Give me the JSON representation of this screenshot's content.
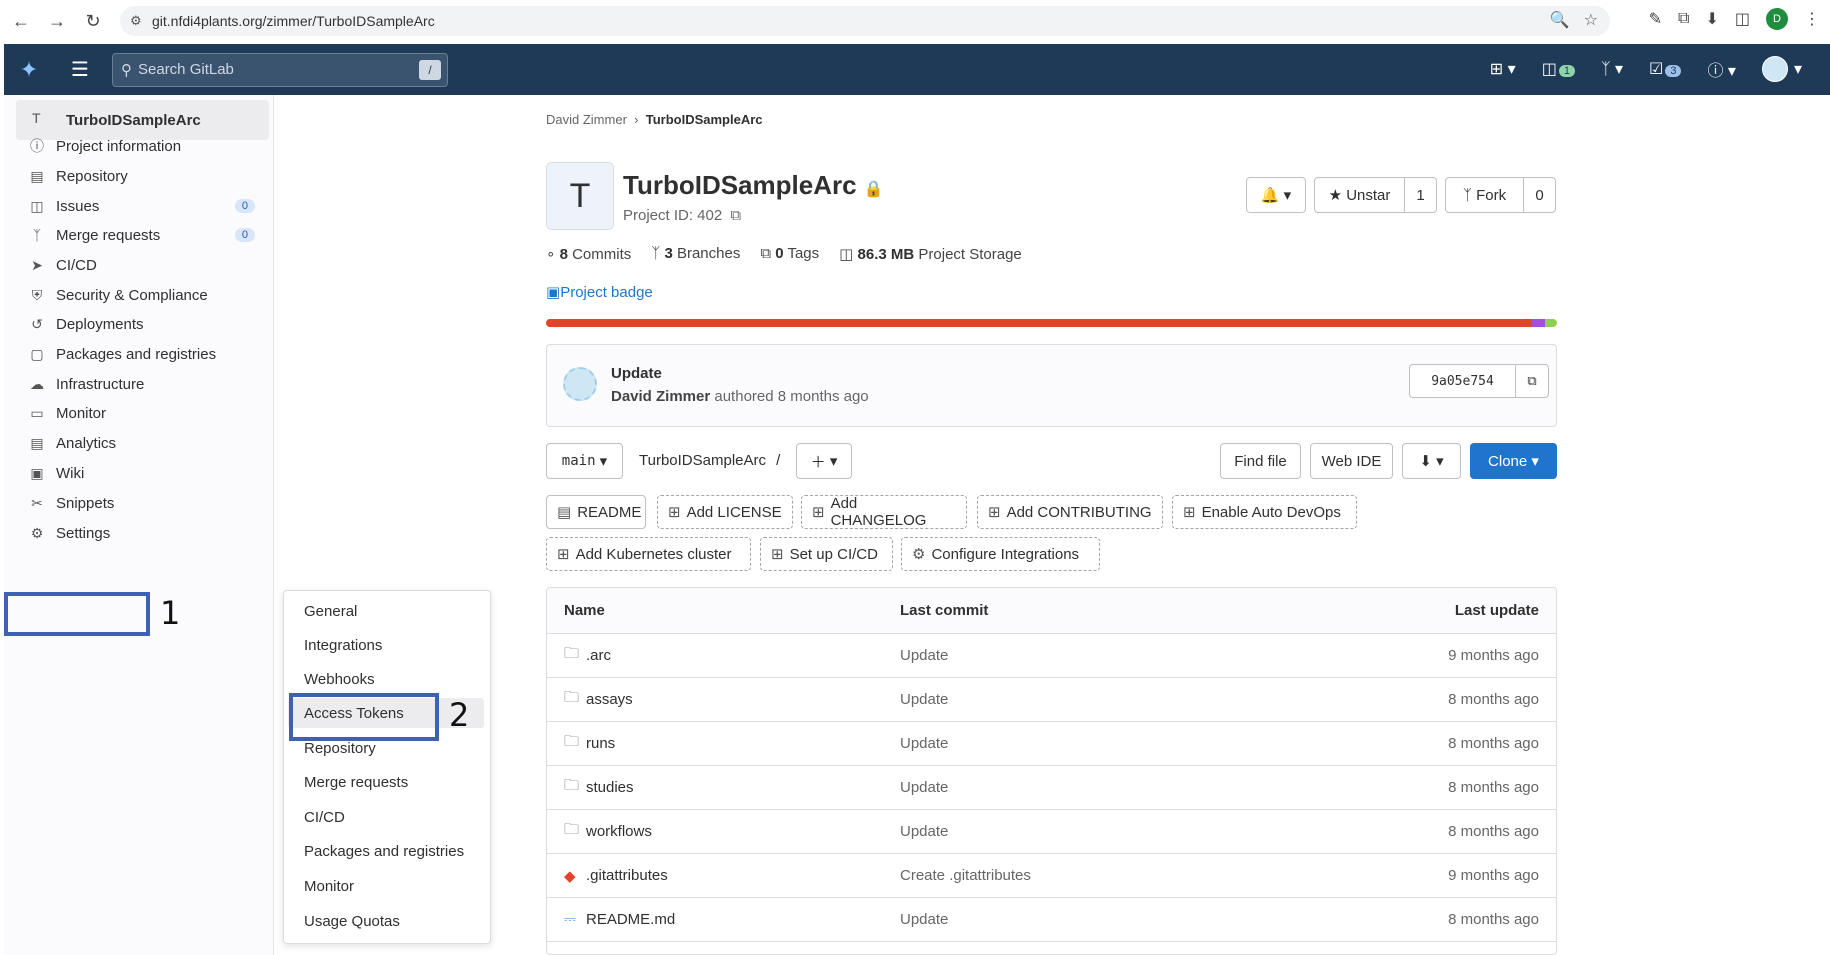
{
  "browser": {
    "url": "git.nfdi4plants.org/zimmer/TurboIDSampleArc",
    "profile_initial": "D"
  },
  "topnav": {
    "search_placeholder": "Search GitLab",
    "search_shortcut": "/",
    "issues_count": "1",
    "todo_count": "3"
  },
  "sidebar": {
    "project_initial": "T",
    "project_name": "TurboIDSampleArc",
    "items": [
      {
        "label": "Project information",
        "icon": "info-icon"
      },
      {
        "label": "Repository",
        "icon": "doc-icon"
      },
      {
        "label": "Issues",
        "icon": "issues-icon",
        "count": "0"
      },
      {
        "label": "Merge requests",
        "icon": "merge-icon",
        "count": "0"
      },
      {
        "label": "CI/CD",
        "icon": "rocket-icon"
      },
      {
        "label": "Security & Compliance",
        "icon": "shield-icon"
      },
      {
        "label": "Deployments",
        "icon": "deploy-icon"
      },
      {
        "label": "Packages and registries",
        "icon": "package-icon"
      },
      {
        "label": "Infrastructure",
        "icon": "cloud-icon"
      },
      {
        "label": "Monitor",
        "icon": "monitor-icon"
      },
      {
        "label": "Analytics",
        "icon": "chart-icon"
      },
      {
        "label": "Wiki",
        "icon": "book-icon"
      },
      {
        "label": "Snippets",
        "icon": "scissors-icon"
      },
      {
        "label": "Settings",
        "icon": "gear-icon"
      }
    ]
  },
  "annotations": {
    "step1": "1",
    "step2": "2"
  },
  "flyout": {
    "items": [
      "General",
      "Integrations",
      "Webhooks",
      "Access Tokens",
      "Repository",
      "Merge requests",
      "CI/CD",
      "Packages and registries",
      "Monitor",
      "Usage Quotas"
    ]
  },
  "breadcrumb": {
    "owner": "David Zimmer",
    "project": "TurboIDSampleArc"
  },
  "project": {
    "initial": "T",
    "title": "TurboIDSampleArc",
    "id_label": "Project ID: 402",
    "unstar_label": "Unstar",
    "star_count": "1",
    "fork_label": "Fork",
    "fork_count": "0"
  },
  "stats": {
    "commits_num": "8",
    "commits_label": "Commits",
    "branches_num": "3",
    "branches_label": "Branches",
    "tags_num": "0",
    "tags_label": "Tags",
    "storage_num": "86.3 MB",
    "storage_label": "Project Storage"
  },
  "badge_alt": "Project badge",
  "language_bar": [
    {
      "color": "#e24329",
      "share": 0.975
    },
    {
      "color": "#a34de3",
      "share": 0.013
    },
    {
      "color": "#8fd14f",
      "share": 0.012
    }
  ],
  "last_commit": {
    "title": "Update",
    "author": "David Zimmer",
    "meta": "authored 8 months ago",
    "sha": "9a05e754"
  },
  "toolbar": {
    "branch": "main",
    "path": "TurboIDSampleArc",
    "path_sep": "/",
    "find_file": "Find file",
    "web_ide": "Web IDE",
    "clone": "Clone"
  },
  "quick_actions": [
    "README",
    "Add LICENSE",
    "Add CHANGELOG",
    "Add CONTRIBUTING",
    "Enable Auto DevOps",
    "Add Kubernetes cluster",
    "Set up CI/CD",
    "Configure Integrations"
  ],
  "table": {
    "headers": {
      "name": "Name",
      "commit": "Last commit",
      "update": "Last update"
    },
    "rows": [
      {
        "name": ".arc",
        "type": "folder",
        "commit": "Update",
        "update": "9 months ago"
      },
      {
        "name": "assays",
        "type": "folder",
        "commit": "Update",
        "update": "8 months ago"
      },
      {
        "name": "runs",
        "type": "folder",
        "commit": "Update",
        "update": "8 months ago"
      },
      {
        "name": "studies",
        "type": "folder",
        "commit": "Update",
        "update": "8 months ago"
      },
      {
        "name": "workflows",
        "type": "folder",
        "commit": "Update",
        "update": "8 months ago"
      },
      {
        "name": ".gitattributes",
        "type": "git",
        "commit": "Create .gitattributes",
        "update": "9 months ago"
      },
      {
        "name": "README.md",
        "type": "markdown",
        "commit": "Update",
        "update": "8 months ago"
      }
    ]
  }
}
